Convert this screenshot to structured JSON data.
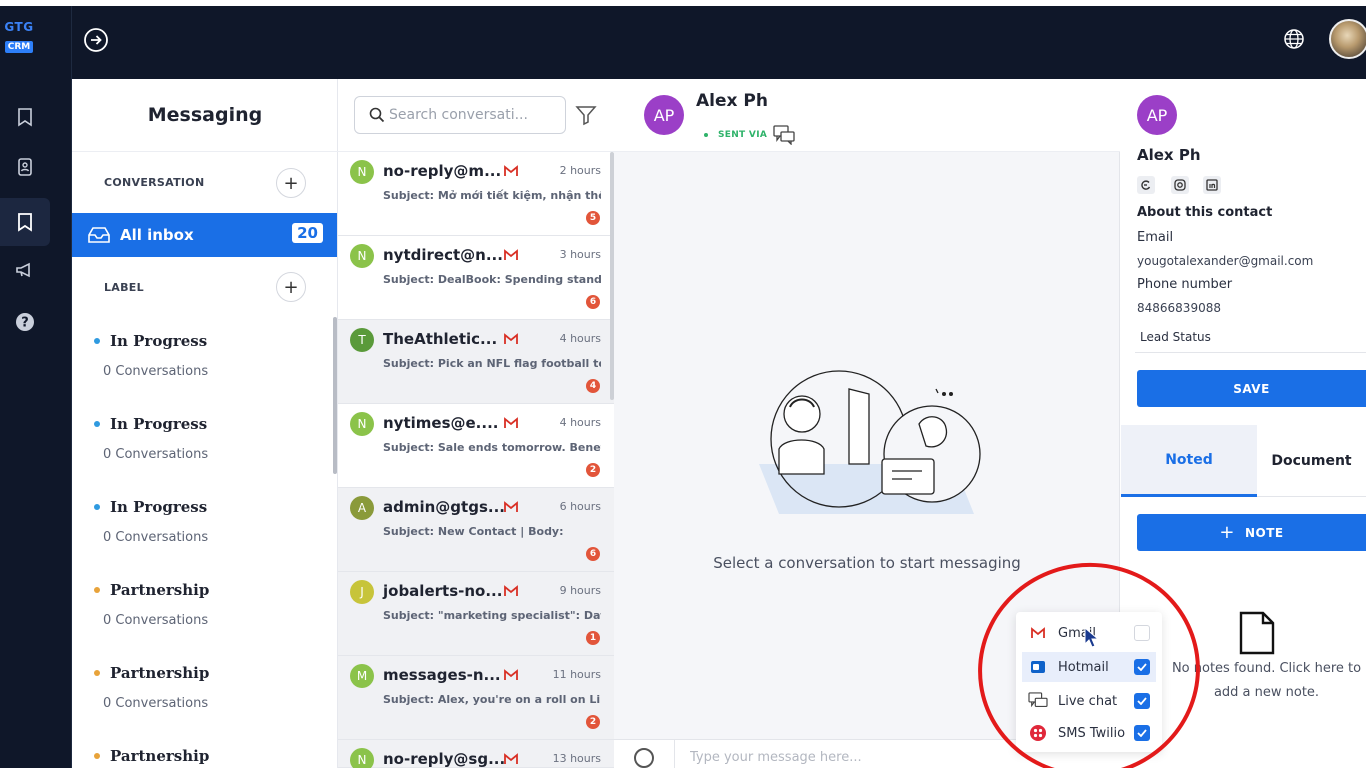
{
  "app": {
    "logo_line1": "GTG",
    "logo_line2": "CRM"
  },
  "messaging": {
    "title": "Messaging",
    "conversation_label": "CONVERSATION",
    "label_label": "LABEL",
    "all_inbox": {
      "label": "All inbox",
      "count": "20"
    },
    "labels": [
      {
        "name": "In Progress",
        "count_text": "0 Conversations",
        "color": "#2f9ae0"
      },
      {
        "name": "In Progress",
        "count_text": "0 Conversations",
        "color": "#2f9ae0"
      },
      {
        "name": "In Progress",
        "count_text": "0 Conversations",
        "color": "#2f9ae0"
      },
      {
        "name": "Partnership",
        "count_text": "0 Conversations",
        "color": "#e8a33a"
      },
      {
        "name": "Partnership",
        "count_text": "0 Conversations",
        "color": "#e8a33a"
      },
      {
        "name": "Partnership",
        "count_text": "",
        "color": "#e8a33a"
      }
    ]
  },
  "conversations": {
    "search_placeholder": "Search conversati...",
    "items": [
      {
        "initial": "N",
        "from": "no-reply@m...",
        "time": "2 hours",
        "subject": "Subject: Mở mới tiết kiệm, nhận thên",
        "badge": "5",
        "color": "#8bc34a"
      },
      {
        "initial": "N",
        "from": "nytdirect@n...",
        "time": "3 hours",
        "subject": "Subject: DealBook: Spending standof",
        "badge": "6",
        "color": "#8bc34a"
      },
      {
        "initial": "T",
        "from": "TheAthletic...",
        "time": "4 hours",
        "subject": "Subject: Pick an NFL flag football teai",
        "badge": "4",
        "color": "#5a9a3a"
      },
      {
        "initial": "N",
        "from": "nytimes@e....",
        "time": "4 hours",
        "subject": "Subject: Sale ends tomorrow. Benefit",
        "badge": "2",
        "color": "#8bc34a"
      },
      {
        "initial": "A",
        "from": "admin@gtgs...",
        "time": "6 hours",
        "subject": "Subject: New Contact | Body:",
        "badge": "6",
        "color": "#8a9a3a"
      },
      {
        "initial": "J",
        "from": "jobalerts-no...",
        "time": "9 hours",
        "subject": "Subject: \"marketing specialist\": Data.",
        "badge": "1",
        "color": "#c7c43a"
      },
      {
        "initial": "M",
        "from": "messages-n...",
        "time": "11 hours",
        "subject": "Subject: Alex, you're on a roll on Link",
        "badge": "2",
        "color": "#8bc34a"
      },
      {
        "initial": "N",
        "from": "no-reply@sg...",
        "time": "13 hours",
        "subject": "",
        "badge": "",
        "color": "#8bc34a"
      }
    ]
  },
  "chat": {
    "contact_initials": "AP",
    "contact_name": "Alex Ph",
    "sent_via": "SENT VIA",
    "empty_message": "Select a conversation to start messaging",
    "composer_placeholder": "Type your message here..."
  },
  "channels": [
    {
      "name": "Gmail",
      "checked": false
    },
    {
      "name": "Hotmail",
      "checked": true
    },
    {
      "name": "Live chat",
      "checked": true
    },
    {
      "name": "SMS Twilio",
      "checked": true
    }
  ],
  "contact": {
    "initials": "AP",
    "name": "Alex Ph",
    "about_title": "About this contact",
    "email_label": "Email",
    "email_value": "yougotalexander@gmail.com",
    "phone_label": "Phone number",
    "phone_value": "84866839088",
    "lead_status_label": "Lead Status",
    "save_label": "SAVE",
    "tab_noted": "Noted",
    "tab_document": "Document",
    "note_button": "NOTE",
    "no_notes_text": "No notes found. Click here to add a new note."
  },
  "colors": {
    "brand_blue": "#1a6fe6",
    "dark_nav": "#0f1729",
    "avatar_purple": "#9b3fc7",
    "annotation_red": "#e31a1a"
  }
}
